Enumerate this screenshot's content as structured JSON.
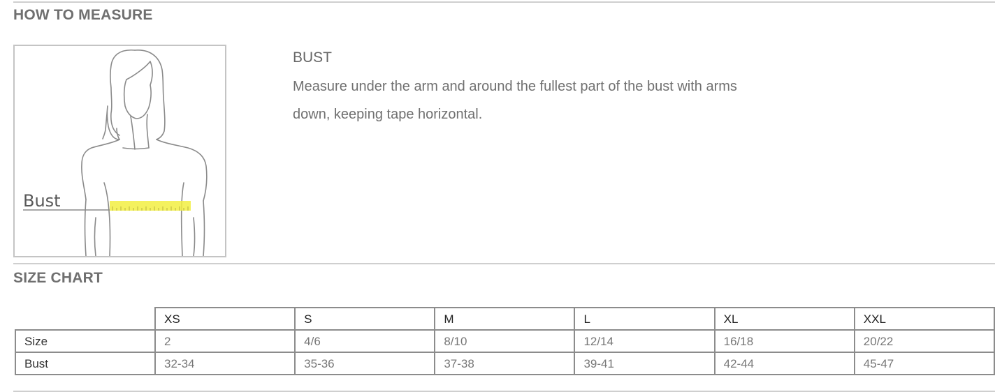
{
  "how_to_measure": {
    "title": "HOW TO MEASURE",
    "diagram": {
      "callout_label": "Bust",
      "tape_color": "#f2ef42"
    },
    "heading": "BUST",
    "text": "Measure under the arm and around the fullest part of the bust with arms down, keeping tape horizontal."
  },
  "size_chart": {
    "title": "SIZE CHART",
    "columns": [
      "XS",
      "S",
      "M",
      "L",
      "XL",
      "XXL"
    ],
    "rows": [
      {
        "label": "Size",
        "values": [
          "2",
          "4/6",
          "8/10",
          "12/14",
          "16/18",
          "20/22"
        ]
      },
      {
        "label": "Bust",
        "values": [
          "32-34",
          "35-36",
          "37-38",
          "39-41",
          "42-44",
          "45-47"
        ]
      }
    ]
  }
}
